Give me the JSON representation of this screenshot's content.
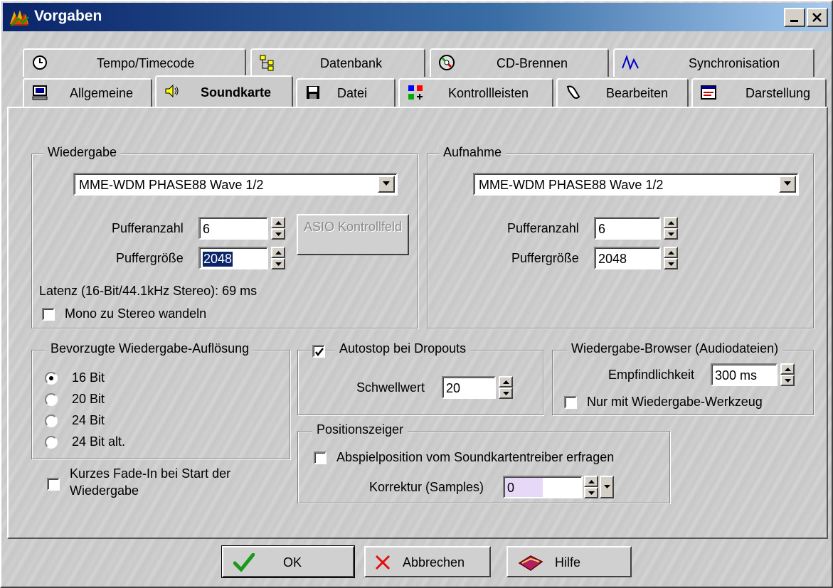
{
  "window": {
    "title": "Vorgaben",
    "title_color_start": "#0a246a",
    "title_color_end": "#a6caf0"
  },
  "tabs_row1": [
    {
      "label": "Tempo/Timecode",
      "icon": "clock-icon"
    },
    {
      "label": "Datenbank",
      "icon": "database-icon"
    },
    {
      "label": "CD-Brennen",
      "icon": "cd-icon"
    },
    {
      "label": "Synchronisation",
      "icon": "sync-wave-icon"
    }
  ],
  "tabs_row2": [
    {
      "label": "Allgemeine",
      "icon": "computer-icon"
    },
    {
      "label": "Soundkarte",
      "icon": "speaker-icon",
      "active": true
    },
    {
      "label": "Datei",
      "icon": "floppy-icon"
    },
    {
      "label": "Kontrollleisten",
      "icon": "toolbar-icon"
    },
    {
      "label": "Bearbeiten",
      "icon": "edit-icon"
    },
    {
      "label": "Darstellung",
      "icon": "display-icon"
    }
  ],
  "playback": {
    "legend": "Wiedergabe",
    "device": "MME-WDM PHASE88 Wave 1/2",
    "buffer_count_label": "Pufferanzahl",
    "buffer_count": "6",
    "buffer_size_label": "Puffergröße",
    "buffer_size": "2048",
    "asio_button": "ASIO Kontrollfeld",
    "latency": "Latenz (16-Bit/44.1kHz Stereo): 69 ms",
    "mono_to_stereo": "Mono zu Stereo wandeln",
    "mono_to_stereo_checked": false
  },
  "recording": {
    "legend": "Aufnahme",
    "device": "MME-WDM PHASE88 Wave 1/2",
    "buffer_count_label": "Pufferanzahl",
    "buffer_count": "6",
    "buffer_size_label": "Puffergröße",
    "buffer_size": "2048"
  },
  "resolution": {
    "legend": "Bevorzugte Wiedergabe-Auflösung",
    "options": [
      "16 Bit",
      "20 Bit",
      "24 Bit",
      "24 Bit alt."
    ],
    "selected": "16 Bit"
  },
  "autostop": {
    "legend": "Autostop bei Dropouts",
    "checked": true,
    "threshold_label": "Schwellwert",
    "threshold": "20"
  },
  "browser": {
    "legend": "Wiedergabe-Browser (Audiodateien)",
    "sensitivity_label": "Empfindlichkeit",
    "sensitivity": "300 ms",
    "only_tool": "Nur mit Wiedergabe-Werkzeug",
    "only_tool_checked": false
  },
  "position": {
    "legend": "Positionszeiger",
    "query_label": "Abspielposition vom Soundkartentreiber erfragen",
    "query_checked": false,
    "correction_label": "Korrektur (Samples)",
    "correction": "0"
  },
  "fade_in": {
    "label_line1": "Kurzes Fade-In bei Start der",
    "label_line2": "Wiedergabe",
    "checked": false
  },
  "buttons": {
    "ok": "OK",
    "cancel": "Abbrechen",
    "help": "Hilfe"
  }
}
